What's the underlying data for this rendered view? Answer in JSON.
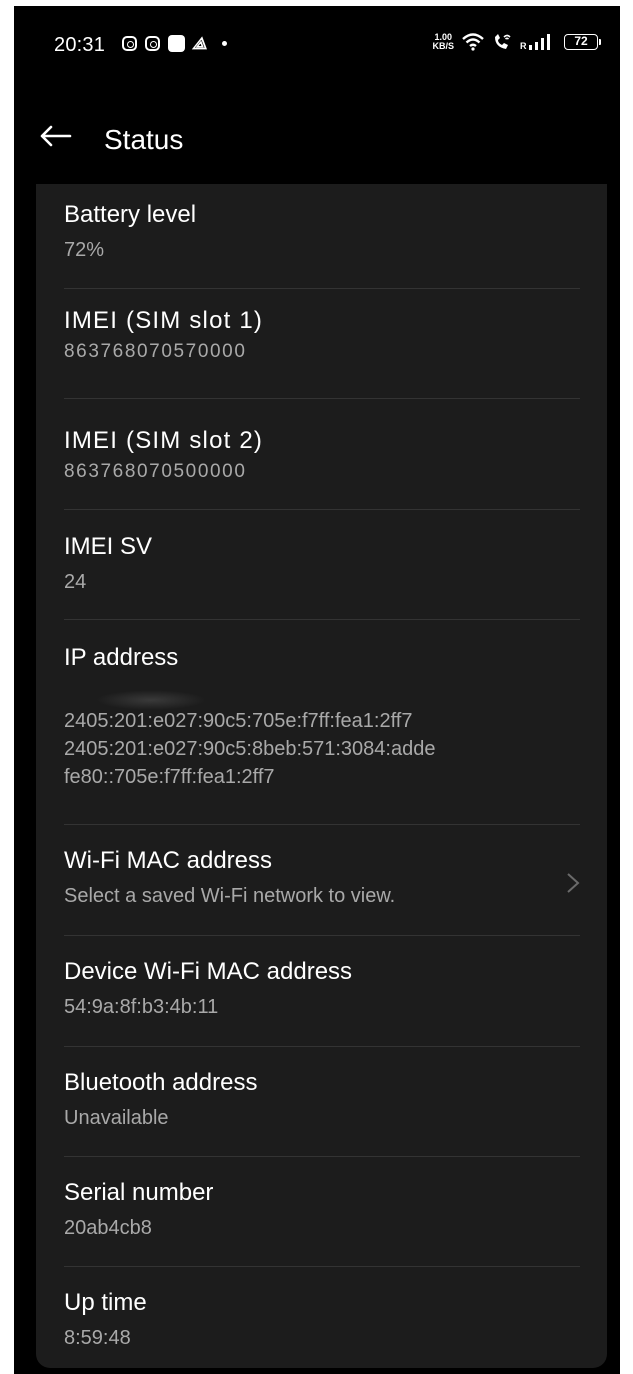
{
  "status_bar": {
    "time": "20:31",
    "net_speed_top": "1.00",
    "net_speed_bottom": "KB/S",
    "roaming": "R",
    "battery": "72"
  },
  "app_bar": {
    "title": "Status"
  },
  "items": [
    {
      "label": "Battery level",
      "value": "72%"
    },
    {
      "label": "IMEI (SIM slot 1)",
      "value": "863768070570000"
    },
    {
      "label": "IMEI (SIM slot 2)",
      "value": "863768070500000"
    },
    {
      "label": "IMEI SV",
      "value": "24"
    },
    {
      "label": "IP address",
      "value": "2405:201:e027:90c5:705e:f7ff:fea1:2ff7\n2405:201:e027:90c5:8beb:571:3084:adde\nfe80::705e:f7ff:fea1:2ff7"
    },
    {
      "label": "Wi-Fi MAC address",
      "value": "Select a saved Wi-Fi network to view."
    },
    {
      "label": "Device Wi-Fi MAC address",
      "value": "54:9a:8f:b3:4b:11"
    },
    {
      "label": "Bluetooth address",
      "value": "Unavailable"
    },
    {
      "label": "Serial number",
      "value": "20ab4cb8"
    },
    {
      "label": "Up time",
      "value": "8:59:48"
    }
  ]
}
